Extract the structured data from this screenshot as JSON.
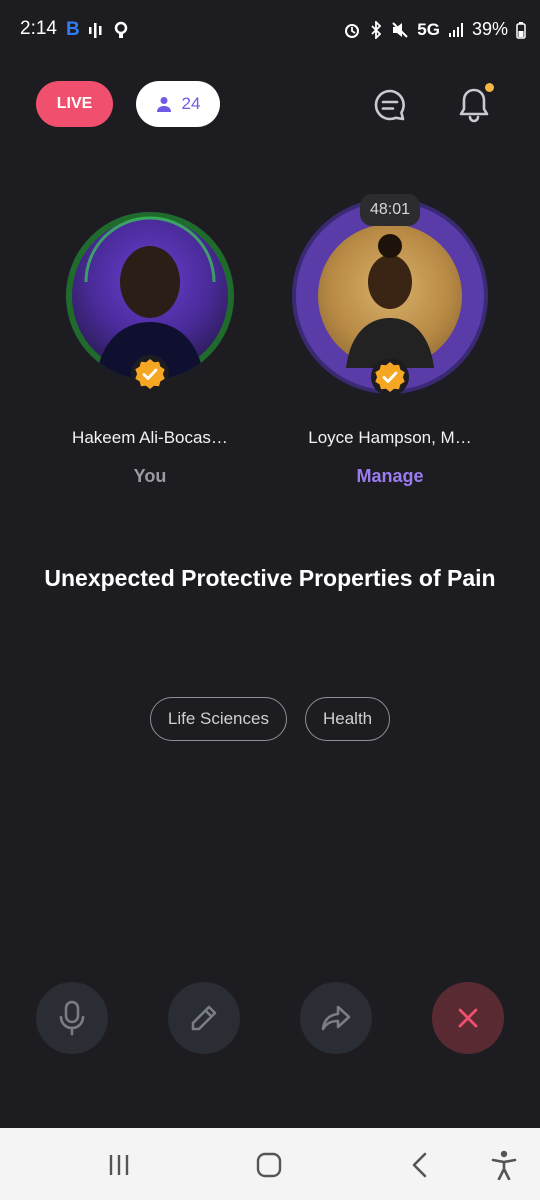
{
  "status_bar": {
    "time": "2:14",
    "left_icon_letter": "B",
    "network": "5G",
    "battery": "39%"
  },
  "header": {
    "live_label": "LIVE",
    "listener_count": "24",
    "has_notification": true
  },
  "speakers": [
    {
      "name": "Hakeem Ali-Bocas…",
      "role": "You",
      "verified": true
    },
    {
      "name": "Loyce Hampson, M…",
      "role": "Manage",
      "verified": true,
      "timer": "48:01"
    }
  ],
  "room": {
    "title": "Unexpected Protective Properties of Pain",
    "tags": [
      "Life Sciences",
      "Health"
    ]
  },
  "colors": {
    "background": "#1d1d21",
    "live": "#f0506e",
    "accent": "#9b7bf0",
    "verified": "#f5a623",
    "notification_dot": "#f5b942"
  },
  "icons": {
    "mic": "microphone-icon",
    "edit": "pencil-icon",
    "share": "share-arrow-icon",
    "leave": "close-icon"
  }
}
